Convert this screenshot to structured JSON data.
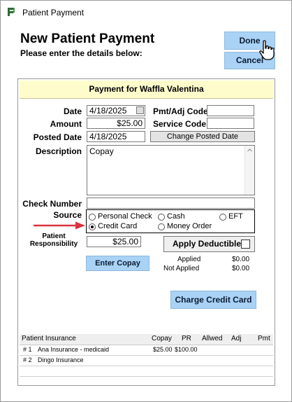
{
  "window": {
    "title": "Patient Payment"
  },
  "header": {
    "title": "New Patient Payment",
    "subtitle": "Please enter the details below:"
  },
  "buttons": {
    "done": "Done",
    "cancel": "Cancel",
    "change_posted_date": "Change Posted Date",
    "apply_deductible": "Apply Deductible",
    "enter_copay": "Enter Copay",
    "charge_credit_card": "Charge Credit Card"
  },
  "panel": {
    "title": "Payment for Waffla Valentina"
  },
  "form": {
    "date_label": "Date",
    "date_value": "4/18/2025",
    "amount_label": "Amount",
    "amount_value": "$25.00",
    "posted_date_label": "Posted Date",
    "posted_date_value": "4/18/2025",
    "pmt_adj_code_label": "Pmt/Adj Code",
    "pmt_adj_code_value": "",
    "service_code_label": "Service Code",
    "service_code_value": "",
    "description_label": "Description",
    "description_value": "Copay",
    "check_number_label": "Check Number",
    "check_number_value": "",
    "source_label": "Source",
    "source_options": [
      "Personal Check",
      "Cash",
      "EFT",
      "Credit Card",
      "Money Order"
    ],
    "source_selected": "Credit Card",
    "patient_resp_label_1": "Patient",
    "patient_resp_label_2": "Responsibility",
    "patient_resp_value": "$25.00",
    "applied_label": "Applied",
    "applied_value": "$0.00",
    "not_applied_label": "Not Applied",
    "not_applied_value": "$0.00"
  },
  "insurance_table": {
    "columns": [
      "Patient Insurance",
      "Copay",
      "PR",
      "Allwed",
      "Adj",
      "Pmt"
    ],
    "rows": [
      {
        "num": "# 1",
        "name": "Ana Insurance - medicaid",
        "copay": "$25.00",
        "pr": "$100.00",
        "allowed": "",
        "adj": "",
        "pmt": ""
      },
      {
        "num": "# 2",
        "name": "Dingo Insurance",
        "copay": "",
        "pr": "",
        "allowed": "",
        "adj": "",
        "pmt": ""
      }
    ]
  },
  "colors": {
    "button_blue": "#a9d2f5",
    "panel_header": "#fefccb",
    "arrow_red": "#d9323f"
  }
}
